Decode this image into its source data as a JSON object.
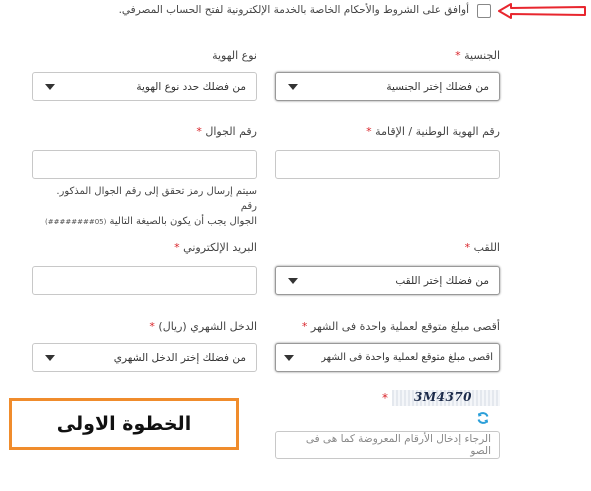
{
  "terms": {
    "checkbox_checked": false,
    "label": "أوافق على الشروط والأحكام الخاصة بالخدمة الإلكترونية لفتح الحساب المصرفي."
  },
  "nationality": {
    "label": "الجنسية",
    "required_mark": "*",
    "selected": "من فضلك إختر الجنسية"
  },
  "id_type": {
    "label": "نوع الهوية",
    "selected": "من فضلك حدد نوع الهوية"
  },
  "national_id": {
    "label": "رقم الهوية الوطنية / الإقامة",
    "required_mark": "*",
    "value": ""
  },
  "mobile": {
    "label": "رقم الجوال",
    "required_mark": "*",
    "value": "",
    "note_line1": "سيتم إرسال رمز تحقق إلى رقم الجوال المذكور. رقم",
    "note_line2": "الجوال يجب أن يكون بالصيغة التالية",
    "note_format": "(05########)"
  },
  "title": {
    "label": "اللقب",
    "required_mark": "*",
    "selected": "من فضلك إختر اللقب"
  },
  "email": {
    "label": "البريد الإلكتروني",
    "required_mark": "*",
    "value": ""
  },
  "max_transaction": {
    "label": "أقصى مبلغ متوقع لعملية واحدة فى الشهر",
    "required_mark": "*",
    "selected": "أقصى مبلغ متوقع لعملية واحدة فى الشهر"
  },
  "monthly_income": {
    "label": "الدخل الشهري (ريال)",
    "required_mark": "*",
    "selected": "من فضلك إختر الدخل الشهري"
  },
  "captcha": {
    "required_mark": "*",
    "image_text": "3M4370",
    "refresh_icon": "refresh-icon",
    "placeholder": "الرجاء إدخال الأرقام المعروضة كما هى فى الصو"
  },
  "step_box": {
    "text": "الخطوة الاولى",
    "border_color": "#f08c2c"
  },
  "arrow_annotation": {
    "color": "#e8262e"
  }
}
